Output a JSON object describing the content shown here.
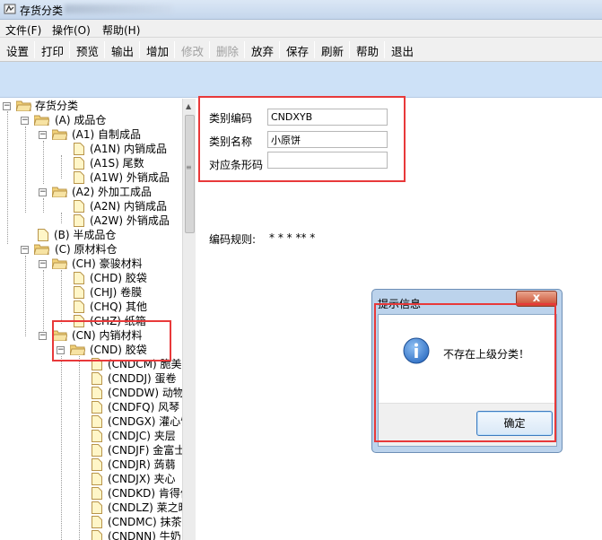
{
  "window": {
    "title": "存货分类"
  },
  "menu": [
    "文件(F)",
    "操作(O)",
    "帮助(H)"
  ],
  "toolbar": [
    {
      "label": "设置",
      "enabled": true
    },
    {
      "label": "打印",
      "enabled": true
    },
    {
      "label": "预览",
      "enabled": true
    },
    {
      "label": "输出",
      "enabled": true
    },
    {
      "label": "增加",
      "enabled": true
    },
    {
      "label": "修改",
      "enabled": false
    },
    {
      "label": "删除",
      "enabled": false
    },
    {
      "label": "放弃",
      "enabled": true
    },
    {
      "label": "保存",
      "enabled": true
    },
    {
      "label": "刷新",
      "enabled": true
    },
    {
      "label": "帮助",
      "enabled": true
    },
    {
      "label": "退出",
      "enabled": true
    }
  ],
  "tree": {
    "root": "存货分类",
    "n_A": "(A) 成品仓",
    "n_A1": "(A1) 自制成品",
    "n_A1N": "(A1N) 内销成品",
    "n_A1S": "(A1S) 尾数",
    "n_A1W": "(A1W) 外销成品",
    "n_A2": "(A2) 外加工成品",
    "n_A2N": "(A2N) 内销成品",
    "n_A2W": "(A2W) 外销成品",
    "n_B": "(B) 半成品仓",
    "n_C": "(C) 原材料仓",
    "n_CH": "(CH) 豪骏材料",
    "n_CHD": "(CHD) 胶袋",
    "n_CHJ": "(CHJ) 卷膜",
    "n_CHQ": "(CHQ) 其他",
    "n_CHZ": "(CHZ) 纸箱",
    "n_CN": "(CN) 内销材料",
    "n_CND": "(CND) 胶袋",
    "leaves": [
      "(CNDCM) 脆美司",
      "(CNDDJ) 蛋卷",
      "(CNDDW) 动物饼",
      "(CNDFQ) 风琴",
      "(CNDGX) 灌心饼",
      "(CNDJC) 夹层",
      "(CNDJF) 金富士",
      "(CNDJR) 蒟蒻",
      "(CNDJX) 夹心",
      "(CNDKD) 肯得佳",
      "(CNDLZ) 莱之旺",
      "(CNDMC) 抹茶",
      "(CNDNN) 牛奶"
    ]
  },
  "form": {
    "code_label": "类别编码",
    "code_value": "CNDXYB",
    "name_label": "类别名称",
    "name_value": "小原饼",
    "barcode_label": "对应条形码",
    "barcode_value": "",
    "rule_label": "编码规则:",
    "rule_value": "* * * ** *"
  },
  "dialog": {
    "title": "提示信息",
    "close": "x",
    "message": "不存在上级分类！",
    "ok": "确定"
  },
  "colors": {
    "highlight_box": "#e8393a",
    "toolbar_strip": "#cde1f7",
    "folder": "#f2d279",
    "info_icon": "#2f6fc4"
  }
}
